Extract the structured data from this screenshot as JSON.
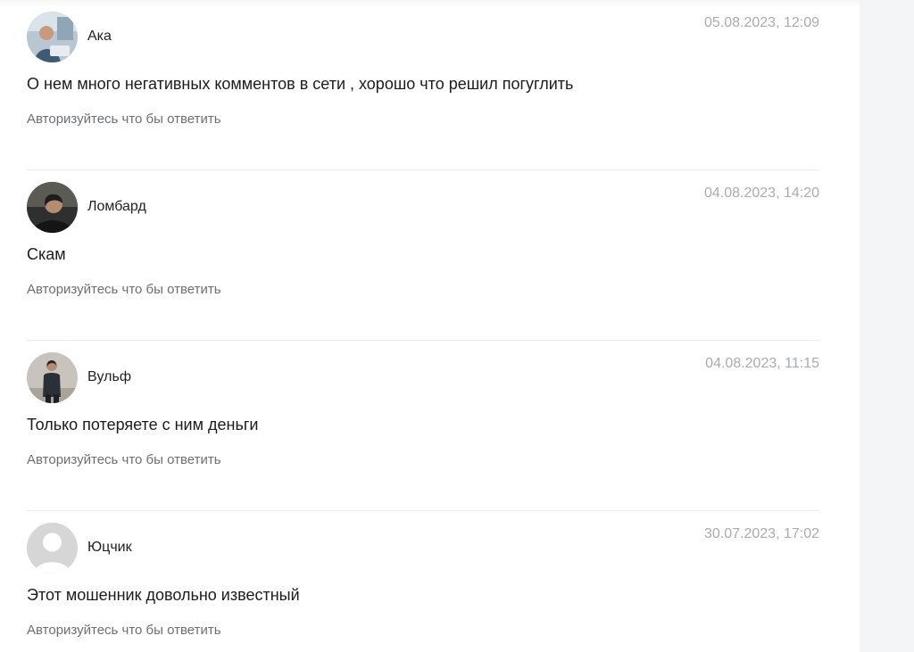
{
  "comments": [
    {
      "author": "Ака",
      "date": "05.08.2023, 12:09",
      "text": "О нем много негативных комментов в сети , хорошо что решил погуглить",
      "reply_label": "Авторизуйтесь что бы ответить",
      "avatar": "photo-person-with-laptop-icon"
    },
    {
      "author": "Ломбард",
      "date": "04.08.2023, 14:20",
      "text": "Скам",
      "reply_label": "Авторизуйтесь что бы ответить",
      "avatar": "photo-person-dark-icon"
    },
    {
      "author": "Вульф",
      "date": "04.08.2023, 11:15",
      "text": "Только потеряете с ним деньги",
      "reply_label": "Авторизуйтесь что бы ответить",
      "avatar": "photo-person-standing-icon"
    },
    {
      "author": "Юцчик",
      "date": "30.07.2023, 17:02",
      "text": "Этот мошенник довольно известный",
      "reply_label": "Авторизуйтесь что бы ответить",
      "avatar": "default-user-icon"
    }
  ],
  "colors": {
    "date": "#a9abb1",
    "reply": "#6d6f74",
    "divider": "#ececec",
    "side_panel": "#f4f5f7"
  }
}
